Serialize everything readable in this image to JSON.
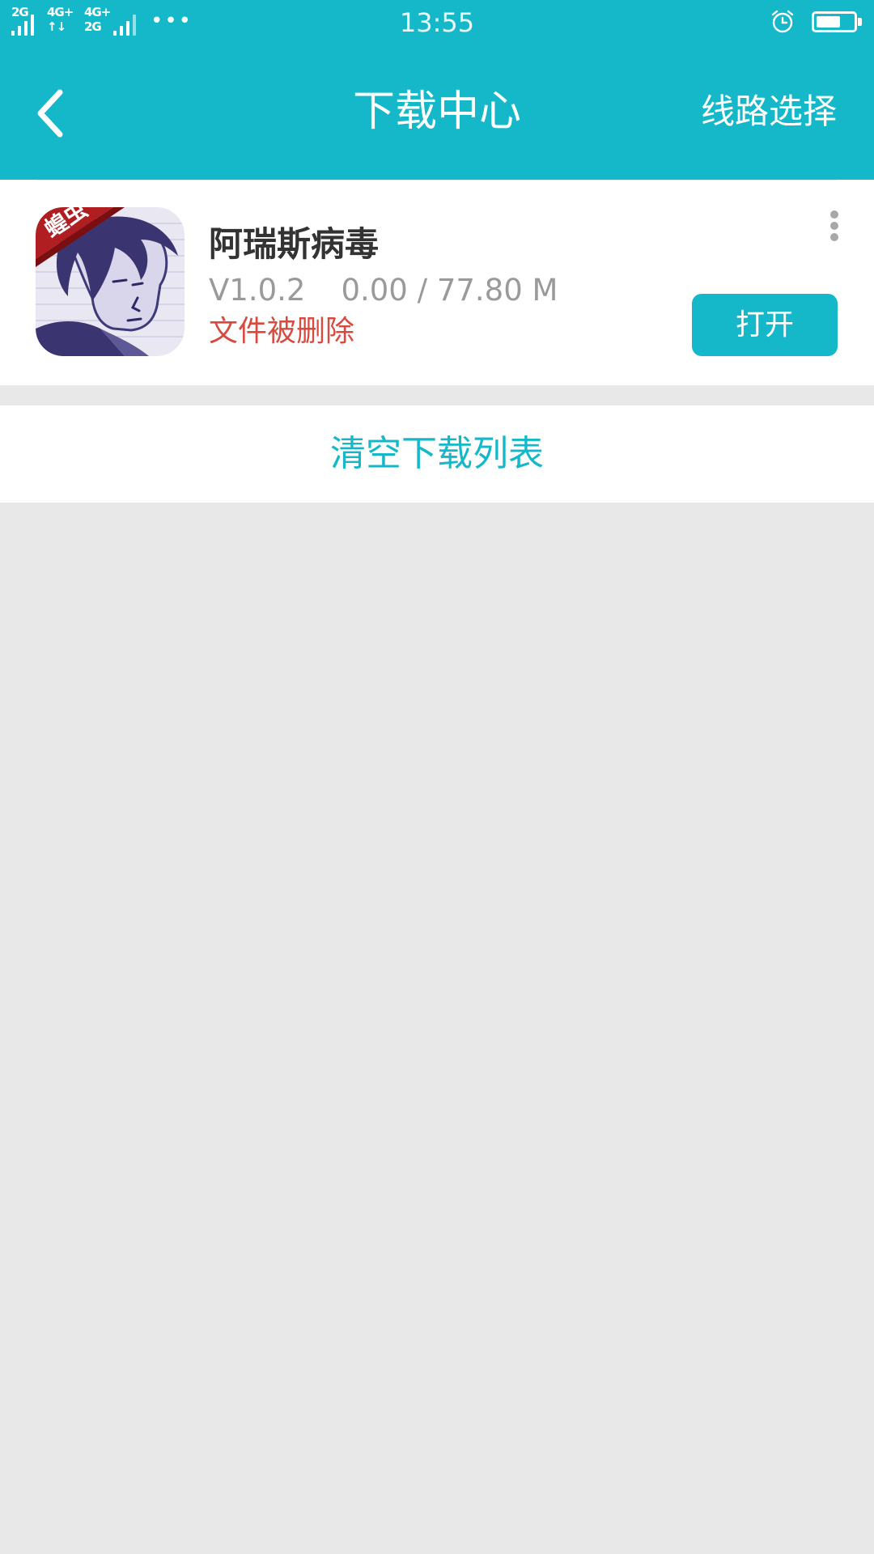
{
  "status_bar": {
    "network_1": "2G",
    "network_2": "4G+",
    "network_3a": "4G+",
    "network_3b": "2G",
    "more": "•••",
    "time": "13:55",
    "alarm_icon": "alarm-clock-icon",
    "battery_icon": "battery-icon",
    "battery_level": 0.65
  },
  "nav": {
    "back_icon": "chevron-left-icon",
    "title": "下载中心",
    "route_select": "线路选择"
  },
  "downloads": [
    {
      "name": "阿瑞斯病毒",
      "version": "V1.0.2",
      "progress": "0.00 / 77.80 M",
      "status": "文件被删除",
      "icon_badge": "蝗虫",
      "action": "打开",
      "more_icon": "more-vertical-icon"
    }
  ],
  "clear_list": "清空下载列表",
  "colors": {
    "accent": "#14b8c8",
    "error": "#d84a3e",
    "background": "#e8e8e8",
    "title_text": "#333333",
    "meta_text": "#9a9a9a"
  }
}
